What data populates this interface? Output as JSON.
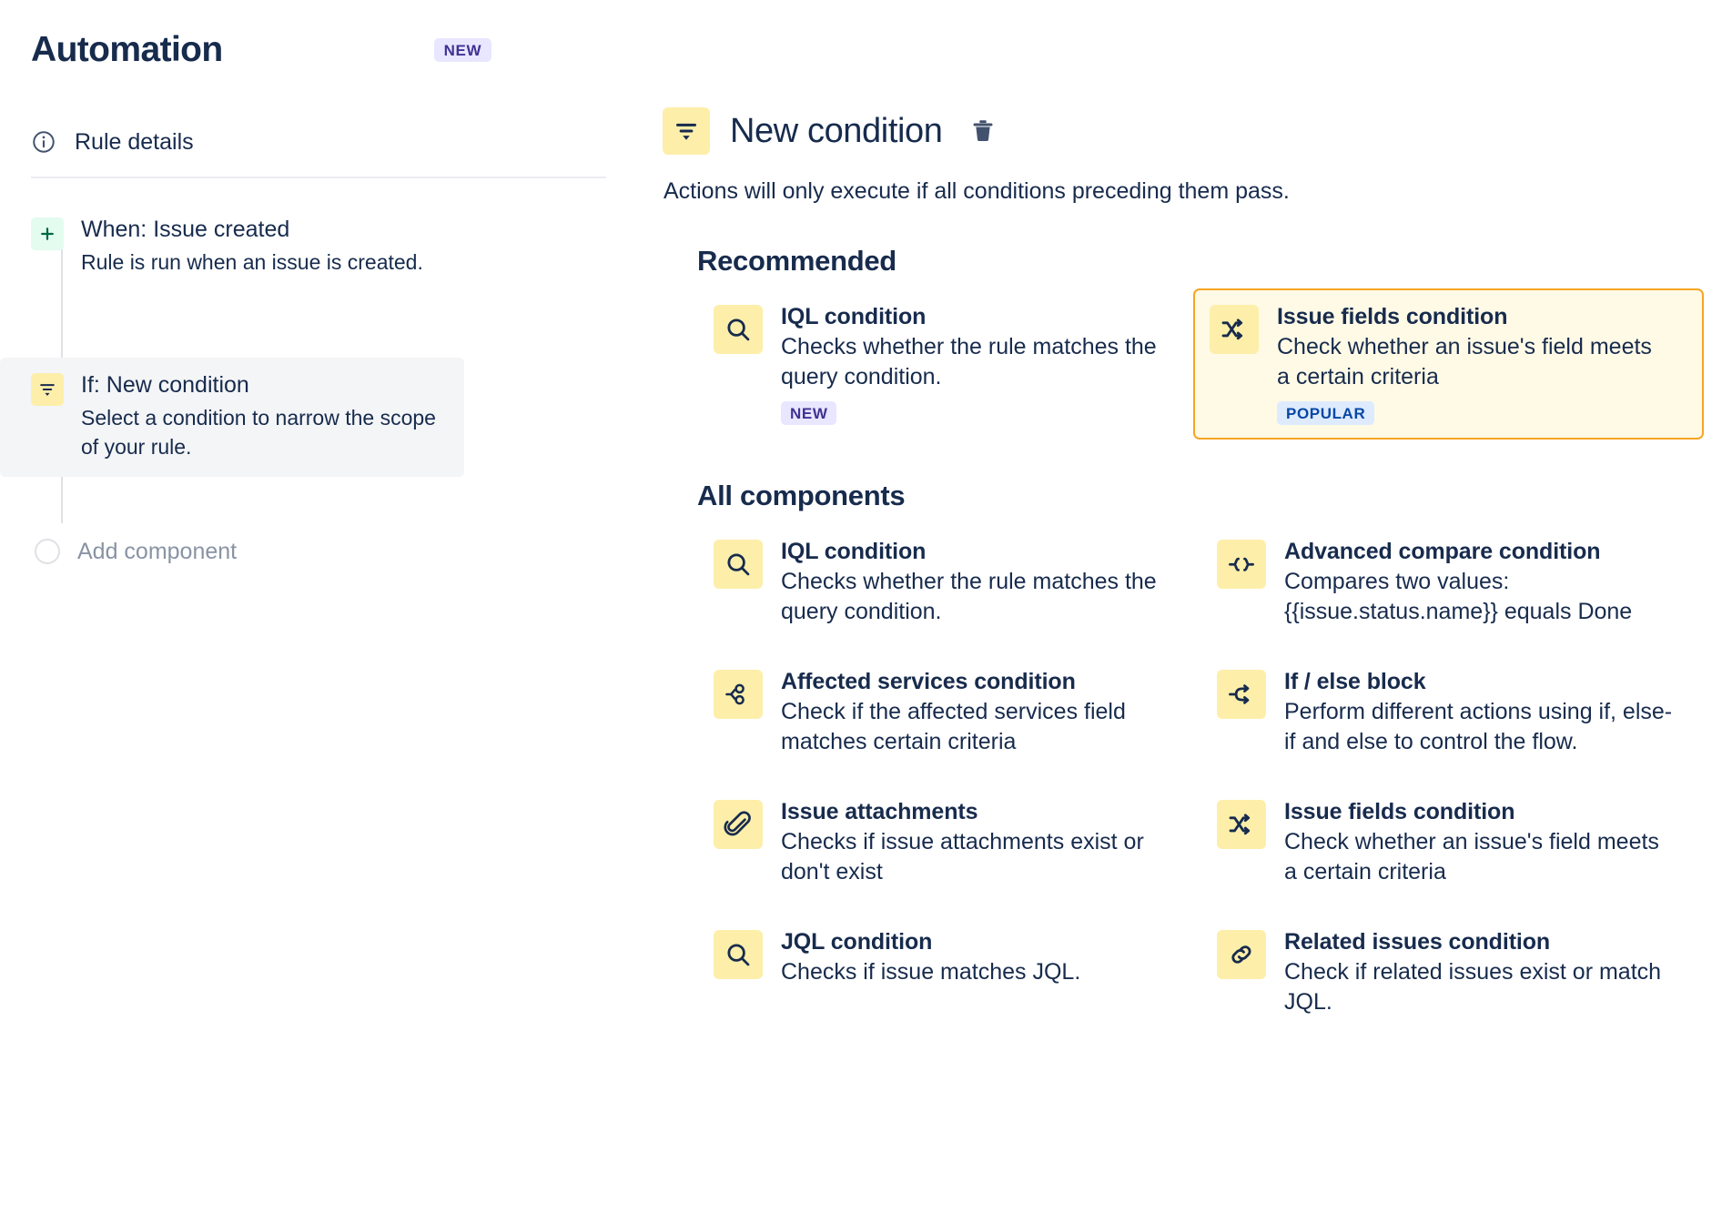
{
  "header": {
    "title": "Automation",
    "badge": "NEW",
    "rule_details_label": "Rule details",
    "info_icon": "info-icon"
  },
  "sidebar": {
    "steps": [
      {
        "icon": "plus-icon",
        "title": "When: Issue created",
        "desc": "Rule is run when an issue is created."
      },
      {
        "icon": "filter-icon",
        "title": "If: New condition",
        "desc": "Select a condition to narrow the scope of your rule."
      }
    ],
    "add_component_label": "Add component"
  },
  "panel": {
    "icon": "filter-icon",
    "title": "New condition",
    "delete_icon": "trash-icon",
    "subtitle": "Actions will only execute if all conditions preceding them pass.",
    "recommended_heading": "Recommended",
    "all_components_heading": "All components"
  },
  "recommended": [
    {
      "icon": "search-icon",
      "title": "IQL condition",
      "desc": "Checks whether the rule matches the query condition.",
      "badge": "NEW",
      "badge_type": "new",
      "selected": false
    },
    {
      "icon": "shuffle-icon",
      "title": "Issue fields condition",
      "desc": "Check whether an issue's field meets a certain criteria",
      "badge": "POPULAR",
      "badge_type": "popular",
      "selected": true
    }
  ],
  "all_components": [
    {
      "icon": "search-icon",
      "title": "IQL condition",
      "desc": "Checks whether the rule matches the query condition."
    },
    {
      "icon": "braces-icon",
      "title": "Advanced compare condition",
      "desc": "Compares two values: {{issue.status.name}} equals Done"
    },
    {
      "icon": "services-branch-icon",
      "title": "Affected services condition",
      "desc": "Check if the affected services field matches certain criteria"
    },
    {
      "icon": "if-else-branch-icon",
      "title": "If / else block",
      "desc": "Perform different actions using if, else-if and else to control the flow."
    },
    {
      "icon": "paperclip-icon",
      "title": "Issue attachments",
      "desc": "Checks if issue attachments exist or don't exist"
    },
    {
      "icon": "shuffle-icon",
      "title": "Issue fields condition",
      "desc": "Check whether an issue's field meets a certain criteria"
    },
    {
      "icon": "search-icon",
      "title": "JQL condition",
      "desc": "Checks if issue matches JQL."
    },
    {
      "icon": "link-icon",
      "title": "Related issues condition",
      "desc": "Check if related issues exist or match JQL."
    }
  ],
  "colors": {
    "text": "#172b4d",
    "icon_tile": "#fdeeaa",
    "highlight_border": "#f5a623",
    "highlight_bg": "#fffae6",
    "badge_new_bg": "#e9e6ff",
    "badge_new_text": "#403294",
    "badge_popular_bg": "#deebff",
    "badge_popular_text": "#0747a6",
    "trigger_tile": "#e3fcef",
    "selected_step_bg": "#f4f5f7",
    "muted": "#8993a4"
  }
}
